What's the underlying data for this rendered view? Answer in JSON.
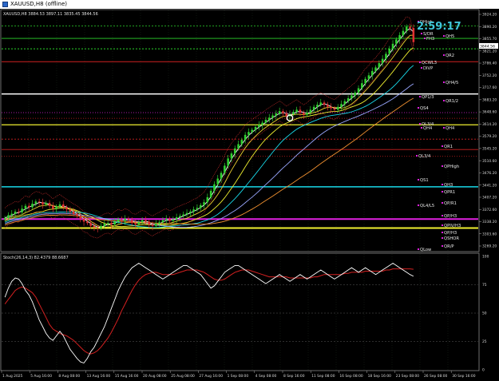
{
  "window": {
    "title": "XAUUSD,H8 (offline)"
  },
  "main_panel": {
    "header": "XAUUSD,H8  3884.53 3897.11 3835.45 3844.56",
    "countdown": "2:59:17",
    "price_badge": "3844.56",
    "price_ticks": [
      "3924.20",
      "3890.20",
      "3855.70",
      "3821.20",
      "3786.40",
      "3752.20",
      "3717.60",
      "3683.20",
      "3648.60",
      "3614.20",
      "3579.20",
      "3545.20",
      "3510.60",
      "3476.20",
      "3441.20",
      "3407.20",
      "3372.60",
      "3338.20",
      "3303.60",
      "3269.20"
    ],
    "level_labels": [
      "DHigh",
      "S/DR",
      "FH3",
      "QH5",
      "QCWL3",
      "QR2",
      "DIVP",
      "QH4/5",
      "QP1/3",
      "QR1/2",
      "QS4",
      "QL3/4",
      "QH4",
      "QH4",
      "QR1",
      "QL3/4",
      "QPHigh",
      "QS1",
      "QH3",
      "QPR1",
      "QP/R1",
      "QL4/L5",
      "QP/H3",
      "QPIV/H3",
      "QP/H3",
      "QSHOR",
      "QR/P",
      "QLow"
    ]
  },
  "stoch_panel": {
    "header": "Stoch(26,14,3) 82.4379 88.6687",
    "ticks": [
      "100",
      "75",
      "50",
      "25",
      "0"
    ]
  },
  "time_axis": {
    "labels": [
      "1 Aug 2025",
      "5 Aug 16:00",
      "8 Aug 08:00",
      "13 Aug 16:00",
      "15 Aug 16:00",
      "20 Aug 08:00",
      "25 Aug 08:00",
      "27 Aug 16:00",
      "1 Sep 08:00",
      "4 Sep 08:00",
      "8 Sep 16:00",
      "11 Sep 08:00",
      "16 Sep 08:00",
      "18 Sep 16:00",
      "23 Sep 08:00",
      "26 Sep 08:00",
      "30 Sep 16:00"
    ]
  },
  "colors": {
    "bull": "#2fd12f",
    "bear": "#e03030",
    "price_badge": "#ffffff",
    "countdown": "#3fc6d8",
    "stoch_main": "#ffffff",
    "stoch_signal": "#d42020",
    "level_magenta": "#e020e0",
    "level_cyan": "#18d8e8",
    "level_yellow": "#f0f030",
    "level_red": "#d02020",
    "level_green": "#2bd42b",
    "axis_text": "#d8d8d8"
  },
  "chart_data": {
    "type": "candlestick",
    "symbol": "XAUUSD",
    "timeframe": "H8",
    "ohlc_last": {
      "open": 3884.53,
      "high": 3897.11,
      "low": 3835.45,
      "close": 3844.56
    },
    "ylim": [
      3269.2,
      3924.2
    ],
    "closes": [
      3354,
      3362,
      3366,
      3372,
      3370,
      3380,
      3388,
      3384,
      3394,
      3400,
      3398,
      3392,
      3396,
      3388,
      3380,
      3386,
      3392,
      3384,
      3378,
      3372,
      3365,
      3360,
      3352,
      3344,
      3340,
      3332,
      3328,
      3326,
      3332,
      3338,
      3340,
      3336,
      3344,
      3350,
      3346,
      3352,
      3348,
      3340,
      3336,
      3342,
      3348,
      3344,
      3336,
      3332,
      3338,
      3342,
      3348,
      3352,
      3346,
      3350,
      3356,
      3360,
      3364,
      3368,
      3372,
      3378,
      3382,
      3390,
      3398,
      3412,
      3430,
      3448,
      3464,
      3480,
      3500,
      3520,
      3534,
      3548,
      3560,
      3572,
      3586,
      3594,
      3600,
      3608,
      3614,
      3620,
      3628,
      3634,
      3640,
      3646,
      3652,
      3646,
      3638,
      3644,
      3650,
      3656,
      3648,
      3642,
      3648,
      3656,
      3664,
      3670,
      3676,
      3670,
      3664,
      3660,
      3656,
      3664,
      3672,
      3680,
      3688,
      3696,
      3704,
      3716,
      3730,
      3742,
      3752,
      3764,
      3774,
      3786,
      3798,
      3812,
      3826,
      3840,
      3852,
      3864,
      3876,
      3888,
      3884,
      3844.56
    ],
    "stoch_main": [
      64,
      72,
      78,
      81,
      80,
      76,
      70,
      66,
      60,
      52,
      44,
      38,
      32,
      28,
      26,
      30,
      34,
      30,
      24,
      18,
      14,
      10,
      7,
      6,
      10,
      16,
      20,
      26,
      32,
      38,
      46,
      54,
      62,
      70,
      76,
      82,
      86,
      90,
      92,
      94,
      92,
      90,
      88,
      86,
      84,
      82,
      80,
      82,
      84,
      86,
      88,
      90,
      92,
      92,
      90,
      88,
      86,
      84,
      80,
      76,
      72,
      74,
      78,
      82,
      86,
      88,
      90,
      92,
      92,
      90,
      88,
      86,
      84,
      82,
      80,
      78,
      76,
      78,
      80,
      82,
      84,
      82,
      80,
      78,
      80,
      82,
      84,
      82,
      80,
      82,
      84,
      86,
      88,
      86,
      84,
      82,
      80,
      82,
      84,
      86,
      88,
      90,
      88,
      86,
      88,
      90,
      88,
      86,
      84,
      86,
      88,
      90,
      92,
      94,
      92,
      90,
      88,
      86,
      84,
      82.44
    ],
    "stoch_signal": [
      58,
      62,
      66,
      70,
      72,
      73,
      72,
      70,
      68,
      64,
      58,
      52,
      46,
      40,
      36,
      34,
      32,
      31,
      30,
      28,
      26,
      23,
      20,
      17,
      15,
      14,
      15,
      17,
      20,
      24,
      28,
      33,
      39,
      45,
      52,
      58,
      64,
      70,
      75,
      79,
      82,
      84,
      85,
      86,
      86,
      85,
      84,
      84,
      84,
      84,
      85,
      86,
      87,
      88,
      88,
      88,
      88,
      87,
      86,
      84,
      82,
      80,
      79,
      79,
      80,
      82,
      84,
      86,
      87,
      88,
      88,
      88,
      87,
      86,
      85,
      84,
      83,
      82,
      82,
      82,
      82,
      82,
      82,
      81,
      81,
      81,
      81,
      81,
      81,
      81,
      82,
      82,
      83,
      84,
      84,
      84,
      84,
      84,
      84,
      85,
      85,
      86,
      86,
      86,
      86,
      87,
      87,
      87,
      87,
      87,
      87,
      88,
      88,
      89,
      89,
      89,
      89,
      89,
      89,
      88.67
    ],
    "stoch_ylim": [
      0,
      100
    ],
    "stoch_levels": [
      75,
      50,
      25
    ]
  }
}
